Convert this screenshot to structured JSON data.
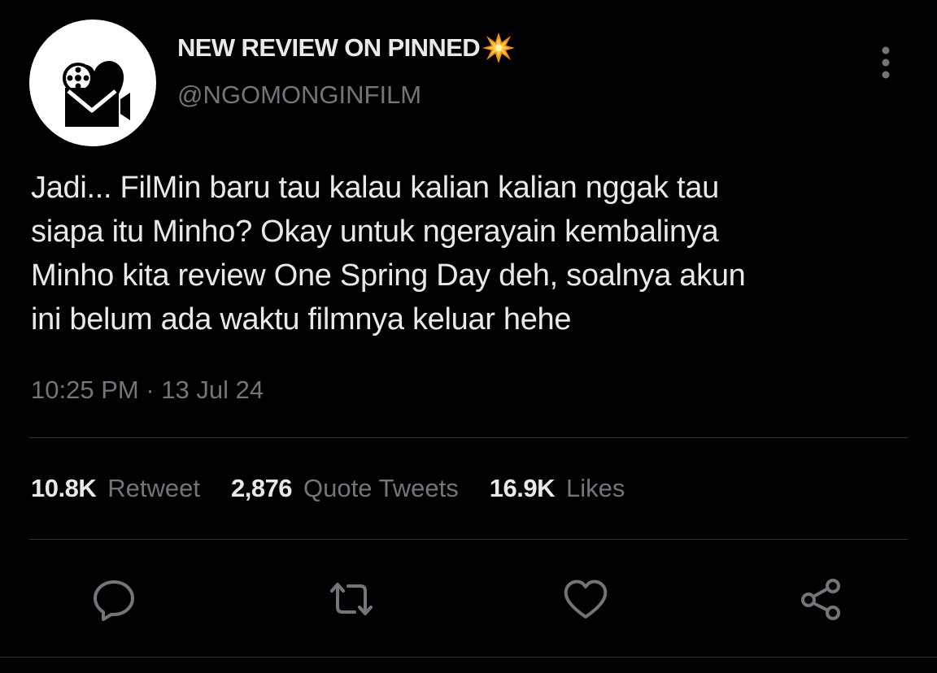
{
  "user": {
    "display_name": "NEW REVIEW ON PINNED",
    "name_emoji_icon": "collision-burst-icon",
    "handle": "@NGOMONGINFILM",
    "avatar_icon": "film-reel-heart-camera-logo"
  },
  "tweet": {
    "lines": [
      "Jadi... FilMin baru tau kalau kalian kalian nggak tau",
      "siapa itu Minho? Okay untuk ngerayain kembalinya",
      "Minho kita review One Spring Day deh, soalnya akun",
      "ini belum ada waktu filmnya keluar hehe"
    ],
    "time": "10:25 PM",
    "separator": "·",
    "date": "13 Jul 24"
  },
  "stats": [
    {
      "count": "10.8K",
      "label": "Retweet"
    },
    {
      "count": "2,876",
      "label": "Quote Tweets"
    },
    {
      "count": "16.9K",
      "label": "Likes"
    }
  ],
  "actions": [
    {
      "icon": "reply-icon"
    },
    {
      "icon": "retweet-icon"
    },
    {
      "icon": "like-heart-icon"
    },
    {
      "icon": "share-icon"
    }
  ],
  "colors": {
    "background": "#000000",
    "text_primary": "#e7e9ea",
    "text_secondary": "#71767b",
    "divider": "#2f3336"
  }
}
